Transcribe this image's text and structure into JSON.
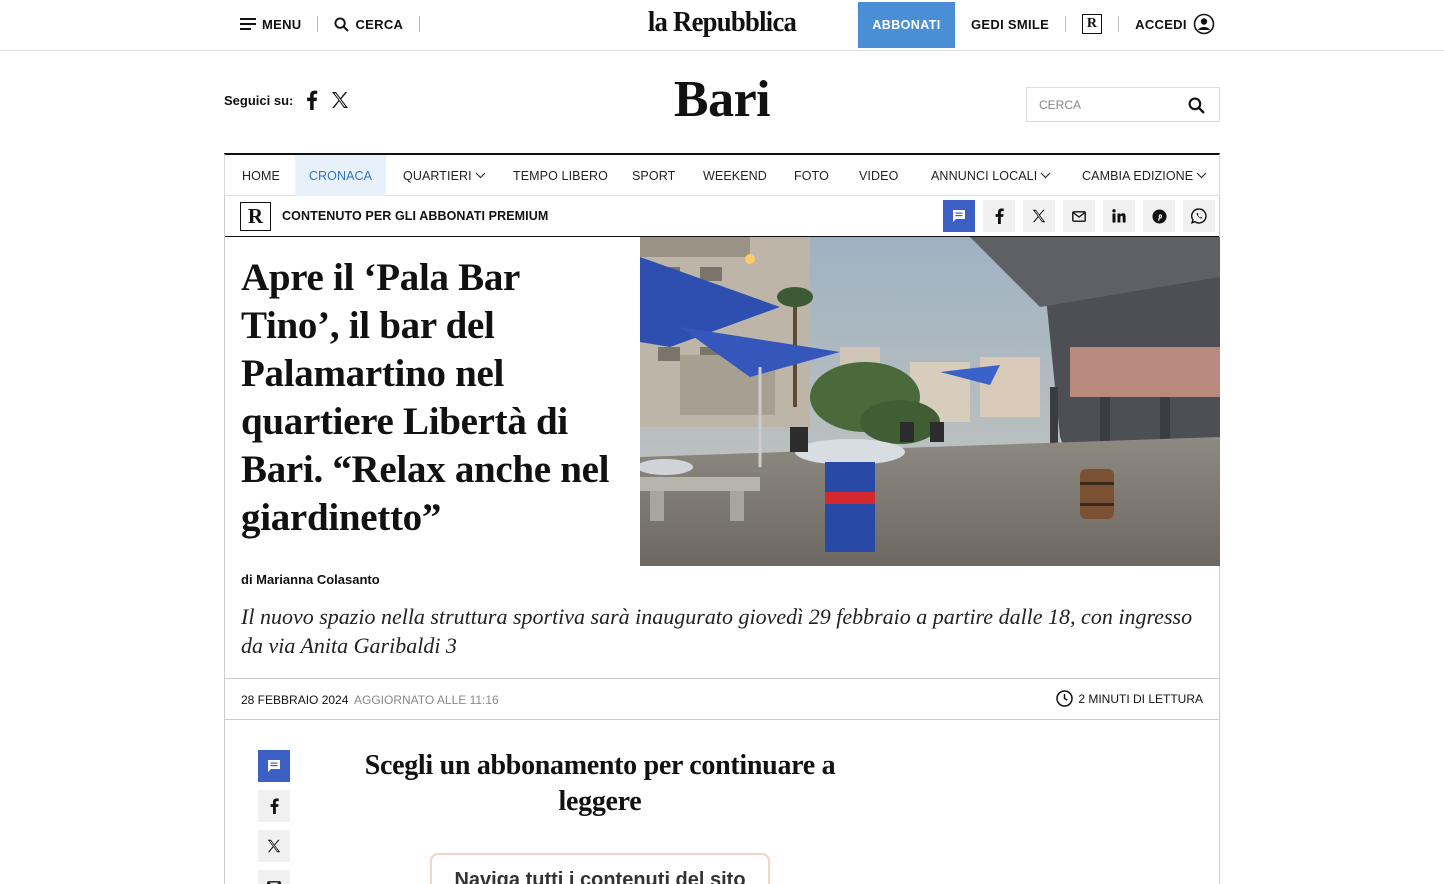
{
  "topbar": {
    "menu_label": "MENU",
    "search_label": "CERCA",
    "logo": "la Repubblica",
    "subscribe_label": "ABBONATI",
    "gedi_label": "GEDI SMILE",
    "premium_badge": "R",
    "login_label": "ACCEDI"
  },
  "edition": {
    "follow_label": "Seguici su:",
    "title": "Bari",
    "search_placeholder": "CERCA"
  },
  "nav": {
    "items": [
      {
        "label": "HOME"
      },
      {
        "label": "CRONACA",
        "active": true
      },
      {
        "label": "QUARTIERI",
        "dropdown": true
      },
      {
        "label": "TEMPO LIBERO"
      },
      {
        "label": "SPORT"
      },
      {
        "label": "WEEKEND"
      },
      {
        "label": "FOTO"
      },
      {
        "label": "VIDEO"
      },
      {
        "label": "ANNUNCI LOCALI",
        "dropdown": true
      },
      {
        "label": "CAMBIA EDIZIONE",
        "dropdown": true
      }
    ]
  },
  "article": {
    "premium_badge": "R",
    "premium_label": "CONTENUTO PER GLI ABBONATI PREMIUM",
    "share_icons": [
      "comment-icon",
      "facebook-icon",
      "x-icon",
      "mail-icon",
      "linkedin-icon",
      "pinterest-icon",
      "whatsapp-icon"
    ],
    "headline": "Apre il ‘Pala Bar Tino’, il bar del Palamartino nel quartiere Libertà di Bari. “Relax anche nel giardinetto”",
    "byline": "di Marianna Colasanto",
    "summary": "Il nuovo spazio nella struttura sportiva sarà inaugurato giovedì 29 febbraio a partire dalle 18, con ingresso da via Anita Garibaldi 3",
    "date": "28 FEBBRAIO 2024",
    "updated": "AGGIORNATO ALLE 11:16",
    "reading_time": "2 MINUTI DI LETTURA"
  },
  "paywall": {
    "title": "Scegli un abbonamento per continuare a leggere",
    "card_text": "Naviga tutti i contenuti del sito"
  },
  "colors": {
    "subscribe_bg": "#4a8fd6",
    "active_nav_text": "#2e77c1",
    "active_nav_bg": "#e8f1fa",
    "comment_btn": "#3b5fc2",
    "card_border": "#f1d3c8"
  }
}
